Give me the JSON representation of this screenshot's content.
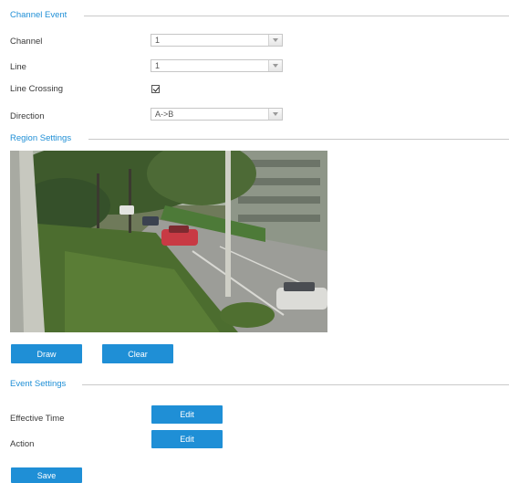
{
  "channel_event": {
    "title": "Channel Event",
    "channel": {
      "label": "Channel",
      "value": "1"
    },
    "line": {
      "label": "Line",
      "value": "1"
    },
    "line_crossing": {
      "label": "Line Crossing",
      "checked": true
    },
    "direction": {
      "label": "Direction",
      "value": "A->B"
    }
  },
  "region_settings": {
    "title": "Region Settings",
    "draw_label": "Draw",
    "clear_label": "Clear"
  },
  "event_settings": {
    "title": "Event Settings",
    "effective_time": {
      "label": "Effective Time",
      "button": "Edit"
    },
    "action": {
      "label": "Action",
      "button": "Edit"
    }
  },
  "save_label": "Save",
  "colors": {
    "accent": "#1f8fd6"
  }
}
